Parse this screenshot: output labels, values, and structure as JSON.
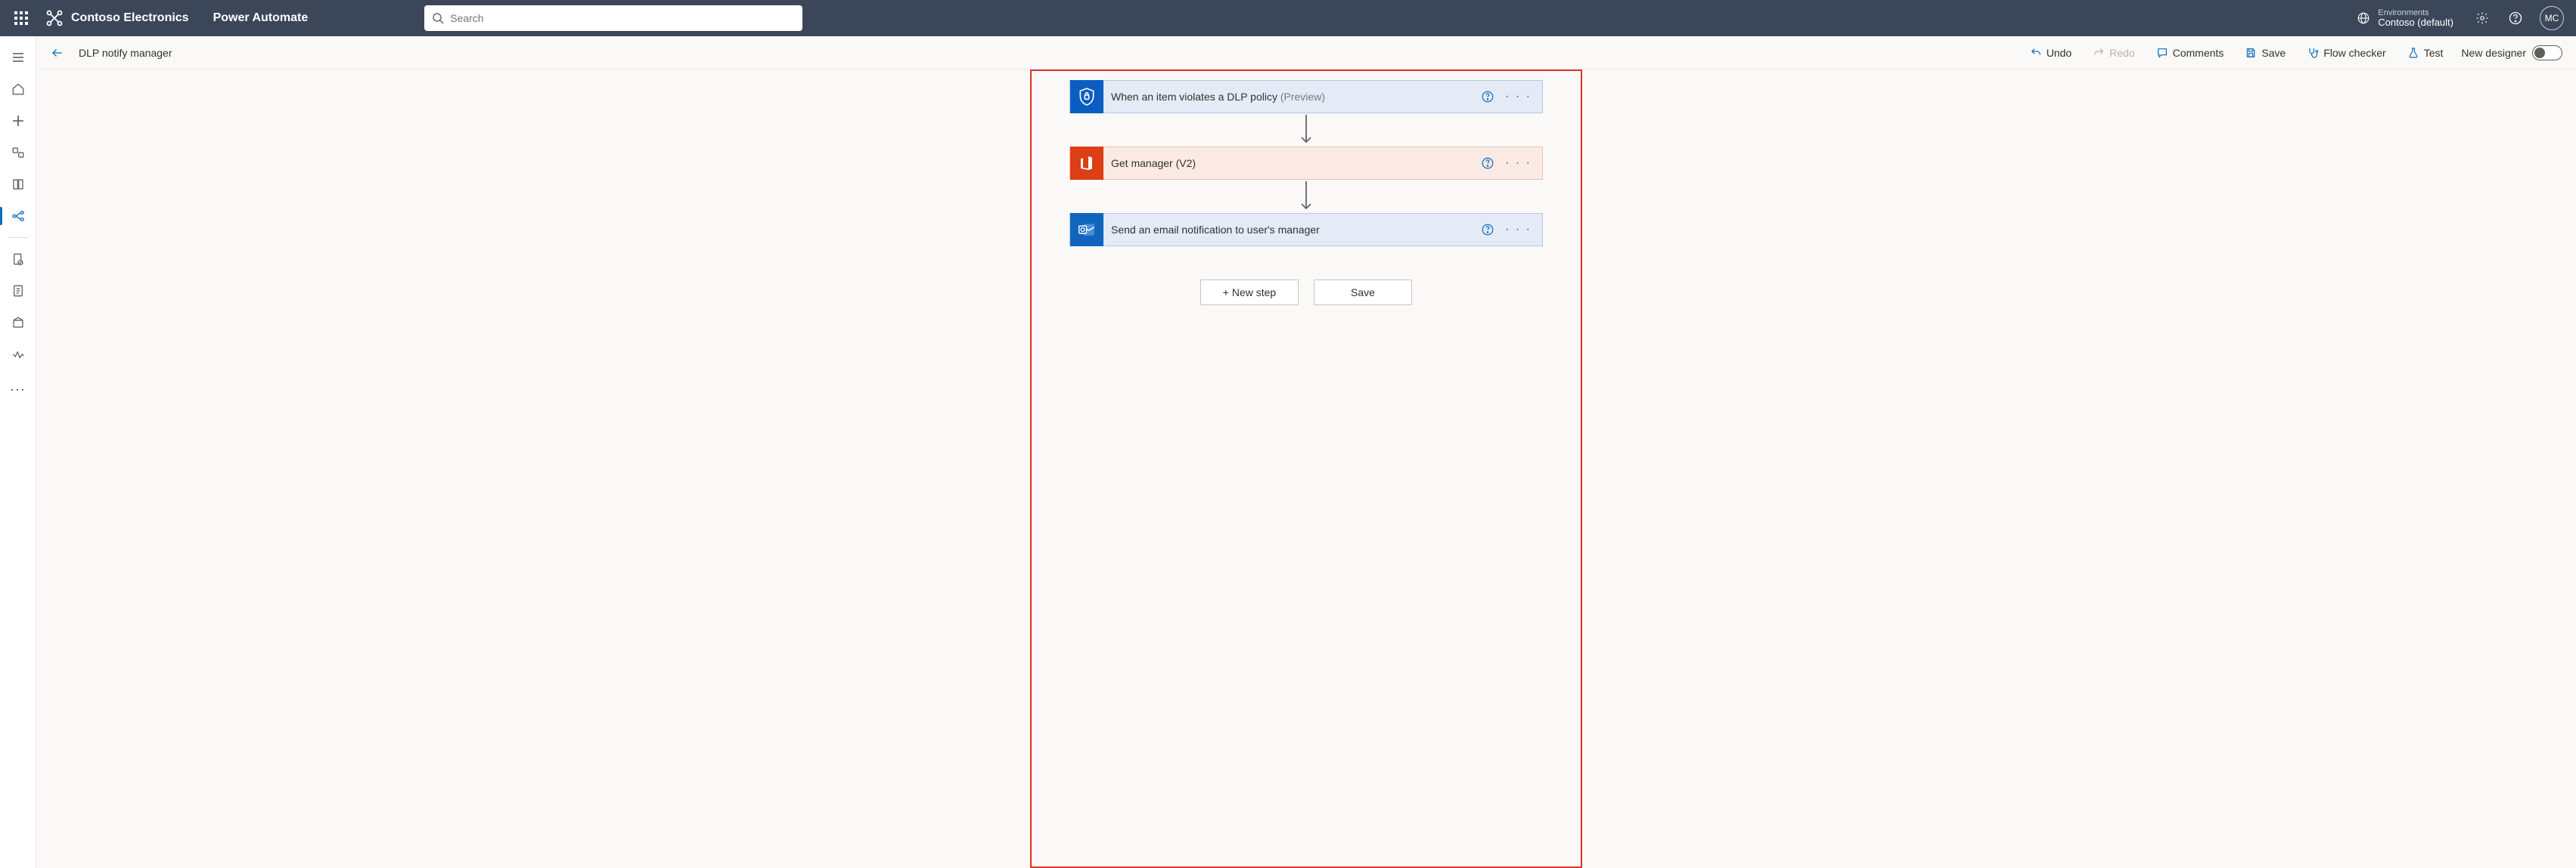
{
  "header": {
    "brand_name": "Contoso Electronics",
    "app_name": "Power Automate",
    "search_placeholder": "Search",
    "env_label": "Environments",
    "env_name": "Contoso (default)",
    "avatar_initials": "MC"
  },
  "command_bar": {
    "flow_title": "DLP notify manager",
    "undo": "Undo",
    "redo": "Redo",
    "comments": "Comments",
    "save": "Save",
    "flow_checker": "Flow checker",
    "test": "Test",
    "new_designer": "New designer"
  },
  "steps": [
    {
      "id": "trigger",
      "title": "When an item violates a DLP policy ",
      "suffix": "(Preview)",
      "style": "blue",
      "icon": "security"
    },
    {
      "id": "get-manager",
      "title": "Get manager (V2)",
      "suffix": "",
      "style": "orange",
      "icon": "office"
    },
    {
      "id": "send-email",
      "title": "Send an email notification to user's manager",
      "suffix": "",
      "style": "blue",
      "icon": "outlook"
    }
  ],
  "footer": {
    "new_step": "+ New step",
    "save": "Save"
  }
}
